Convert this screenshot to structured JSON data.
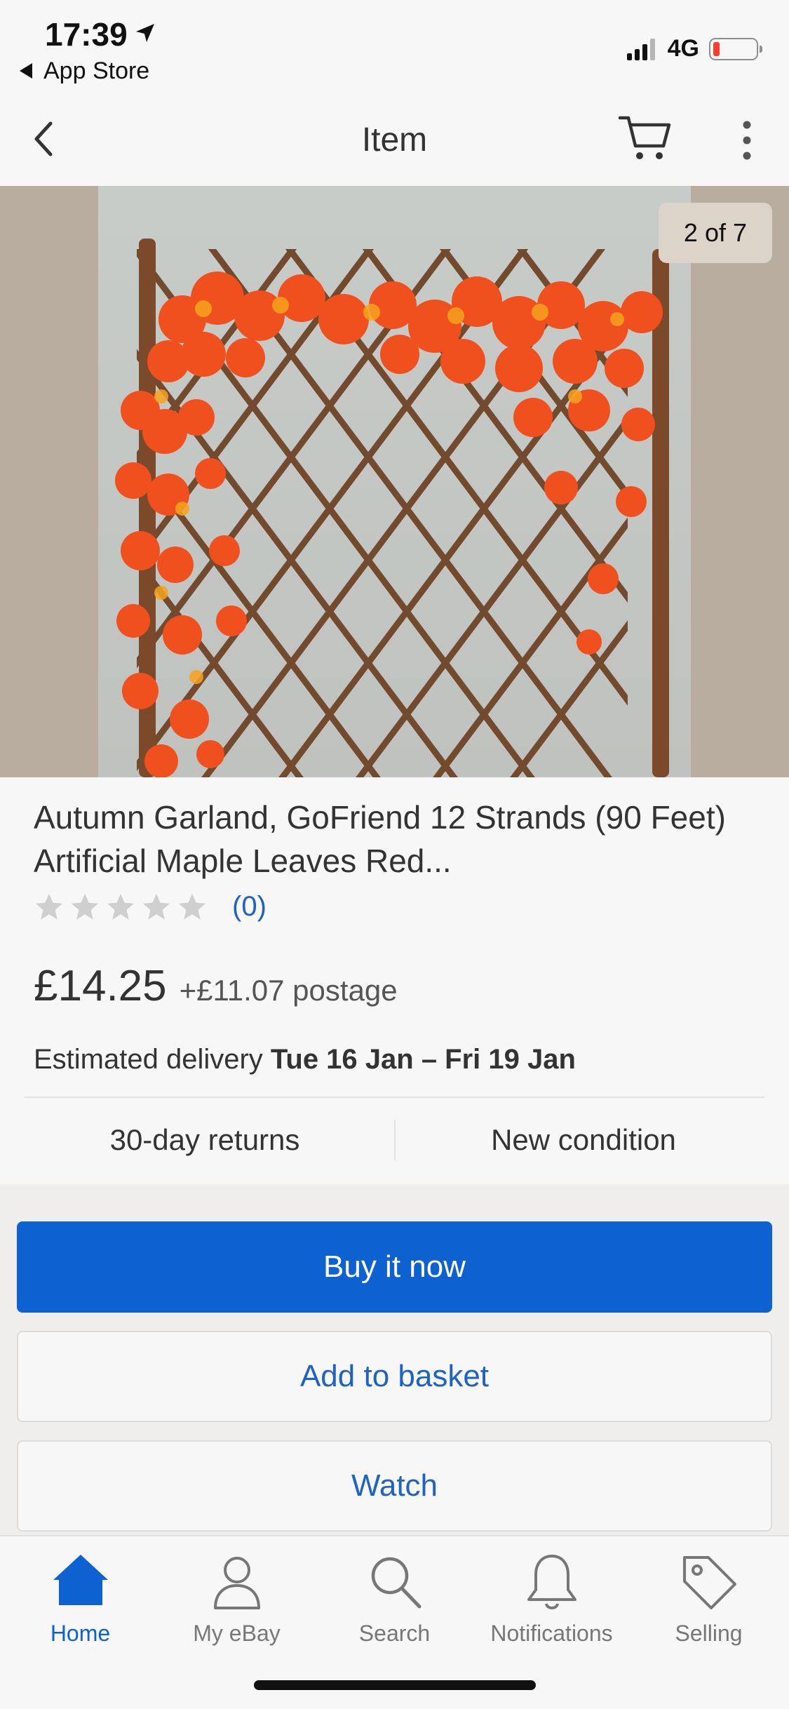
{
  "status_bar": {
    "time": "17:39",
    "back_app": "App Store",
    "network": "4G",
    "icons": [
      "location-arrow-icon",
      "signal-icon",
      "battery-icon"
    ]
  },
  "nav": {
    "title": "Item",
    "icons": [
      "back-chevron-icon",
      "cart-icon",
      "more-vertical-icon"
    ]
  },
  "gallery": {
    "counter": "2 of 7"
  },
  "item": {
    "title": "Autumn Garland, GoFriend 12 Strands (90 Feet) Artificial Maple Leaves Red...",
    "rating_stars": 0,
    "rating_max": 5,
    "rating_count": "(0)",
    "price": "£14.25",
    "postage": "+£11.07 postage",
    "delivery_label": "Estimated delivery",
    "delivery_dates": "Tue 16 Jan – Fri 19 Jan",
    "returns": "30-day returns",
    "condition": "New condition"
  },
  "actions": {
    "buy_now": "Buy it now",
    "add_to_basket": "Add to basket",
    "watch": "Watch"
  },
  "tabs": [
    {
      "label": "Home",
      "icon": "home-icon",
      "active": true
    },
    {
      "label": "My eBay",
      "icon": "person-icon",
      "active": false
    },
    {
      "label": "Search",
      "icon": "search-icon",
      "active": false
    },
    {
      "label": "Notifications",
      "icon": "bell-icon",
      "active": false
    },
    {
      "label": "Selling",
      "icon": "tag-icon",
      "active": false
    }
  ],
  "colors": {
    "accent": "#0e61d1",
    "link": "#1d62c4",
    "battery_low": "#ff3b30",
    "leaves": "#f0501e"
  }
}
